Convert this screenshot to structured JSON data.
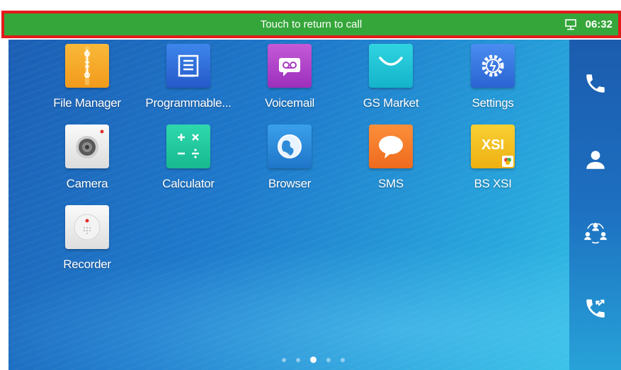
{
  "status_bar": {
    "call_banner": "Touch to return to call",
    "time": "06:32",
    "icons": [
      "network-screen-icon"
    ]
  },
  "apps": [
    {
      "label": "File Manager",
      "icon": "file-manager-icon",
      "color": "#f5a623"
    },
    {
      "label": "Programmable...",
      "icon": "programmable-keys-icon",
      "color": "#2f6fd6"
    },
    {
      "label": "Voicemail",
      "icon": "voicemail-icon",
      "color": "#b540c8"
    },
    {
      "label": "GS Market",
      "icon": "gs-market-icon",
      "color": "#1cc3d6"
    },
    {
      "label": "Settings",
      "icon": "settings-gear-icon",
      "color": "#3677e0"
    },
    {
      "label": "Camera",
      "icon": "camera-icon",
      "color": "#eeeeee"
    },
    {
      "label": "Calculator",
      "icon": "calculator-icon",
      "color": "#22c9a0"
    },
    {
      "label": "Browser",
      "icon": "browser-globe-icon",
      "color": "#2a8bd8"
    },
    {
      "label": "SMS",
      "icon": "sms-bubble-icon",
      "color": "#f57d2a"
    },
    {
      "label": "BS XSI",
      "icon": "bs-xsi-icon",
      "color": "#f3c21a",
      "badge_text": "XSI"
    },
    {
      "label": "Recorder",
      "icon": "recorder-icon",
      "color": "#eeeeee"
    }
  ],
  "side_bar": {
    "buttons": [
      "phone-icon",
      "contacts-icon",
      "conference-icon",
      "call-history-icon"
    ]
  },
  "page_indicator": {
    "count": 5,
    "active_index": 2
  }
}
